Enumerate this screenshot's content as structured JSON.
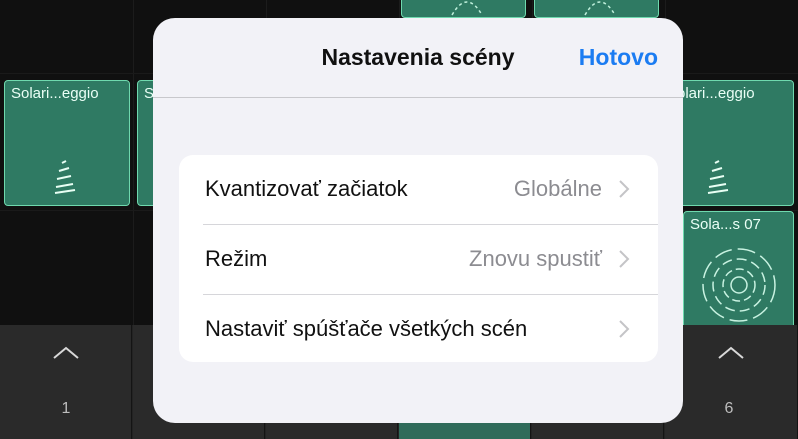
{
  "clips": {
    "left": {
      "label": "Solari...eggio"
    },
    "second": {
      "label": "S"
    },
    "right": {
      "label": "olari...eggio"
    },
    "right_lower": {
      "label": "Sola...s 07"
    }
  },
  "triggers": [
    {
      "number": "1"
    },
    {
      "number": "6"
    }
  ],
  "popover": {
    "title": "Nastavenia scény",
    "done_label": "Hotovo",
    "rows": [
      {
        "label": "Kvantizovať začiatok",
        "value": "Globálne"
      },
      {
        "label": "Režim",
        "value": "Znovu spustiť"
      },
      {
        "label": "Nastaviť spúšťače všetkých scén",
        "value": ""
      }
    ]
  },
  "colors": {
    "accent": "#1b7cf2",
    "clip_fill": "#2f7a63",
    "clip_border": "#6fd9ae",
    "popover_bg": "#f2f2f7"
  },
  "icons": [
    "chevron-right-icon",
    "chevron-up-icon",
    "waveform-icon",
    "circular-pattern-icon"
  ]
}
